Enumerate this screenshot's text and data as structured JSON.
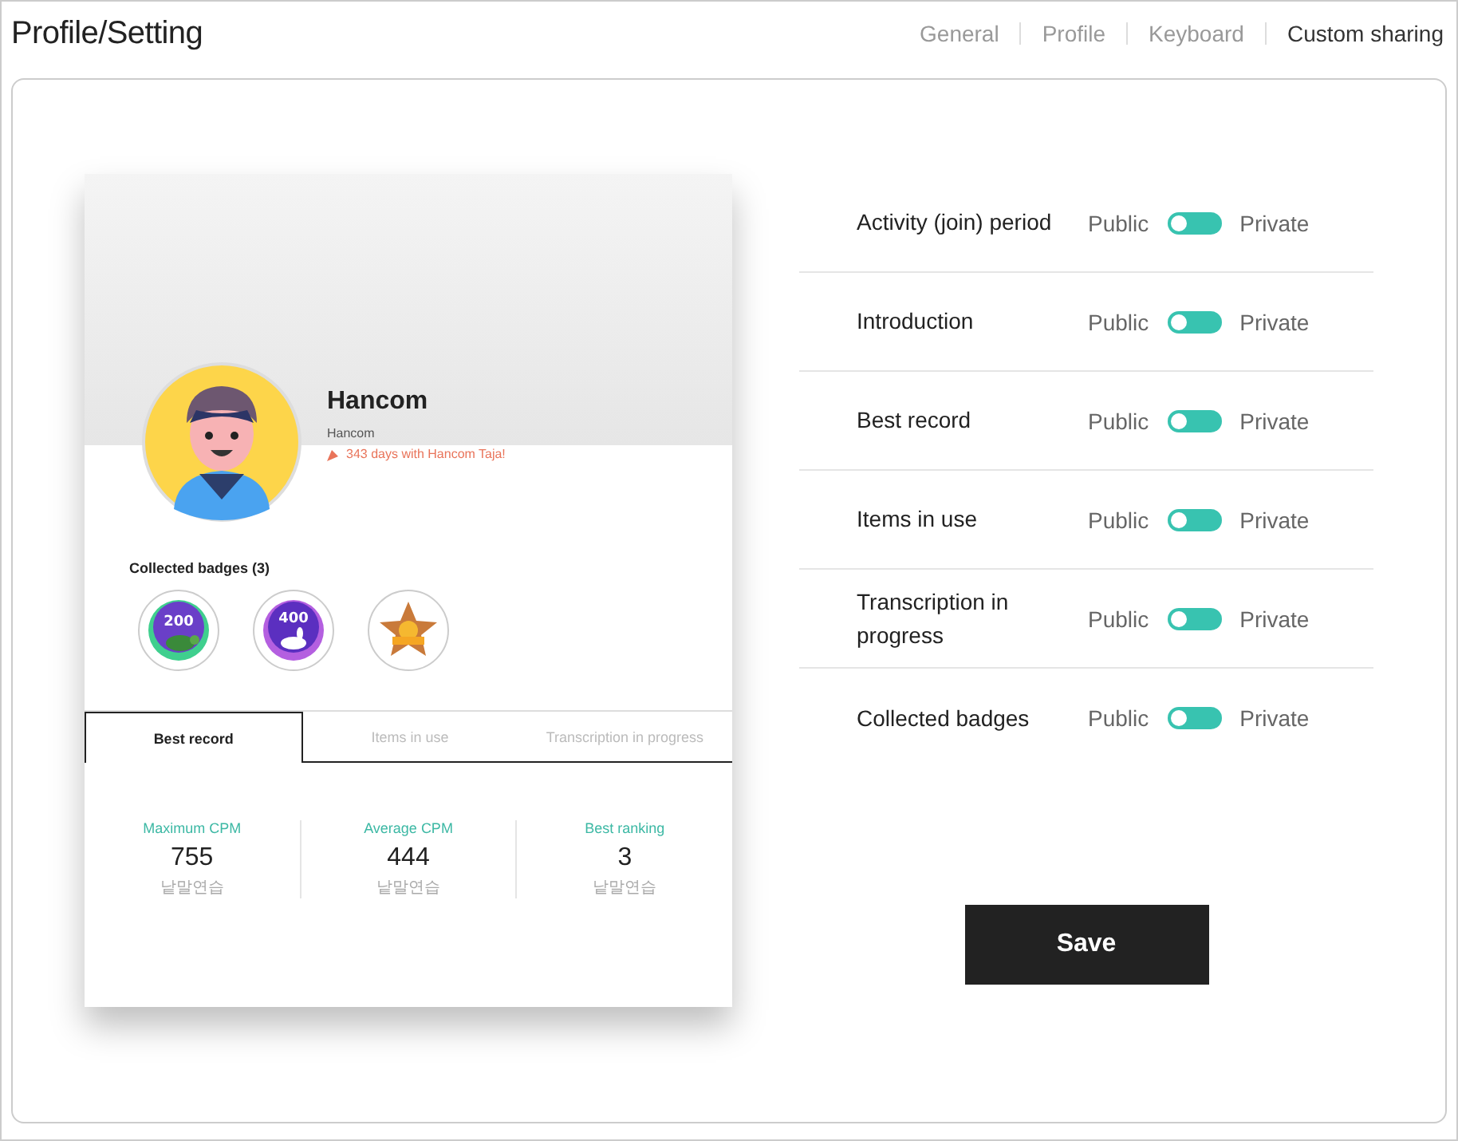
{
  "header": {
    "title": "Profile/Setting",
    "tabs": [
      {
        "label": "General",
        "selected": false
      },
      {
        "label": "Profile",
        "selected": false
      },
      {
        "label": "Keyboard",
        "selected": false
      },
      {
        "label": "Custom sharing",
        "selected": true
      }
    ]
  },
  "profile_card": {
    "name": "Hancom",
    "username": "Hancom",
    "days": "343 days with Hancom Taja!",
    "badges_title": "Collected badges (3)",
    "badges": [
      {
        "kind": "turtle",
        "label": "200"
      },
      {
        "kind": "rabbit",
        "label": "400"
      },
      {
        "kind": "star"
      }
    ],
    "tabs": [
      {
        "label": "Best record",
        "selected": true
      },
      {
        "label": "Items in use",
        "selected": false
      },
      {
        "label": "Transcription in progress",
        "selected": false
      }
    ],
    "stats": [
      {
        "label": "Maximum CPM",
        "value": "755",
        "caption": "낱말연습"
      },
      {
        "label": "Average CPM",
        "value": "444",
        "caption": "낱말연습"
      },
      {
        "label": "Best ranking",
        "value": "3",
        "caption": "낱말연습"
      }
    ]
  },
  "settings": [
    {
      "name": "Activity (join) period",
      "left": "Public",
      "right": "Private",
      "private": false
    },
    {
      "name": "Introduction",
      "left": "Public",
      "right": "Private",
      "private": false
    },
    {
      "name": "Best record",
      "left": "Public",
      "right": "Private",
      "private": false
    },
    {
      "name": "Items in use",
      "left": "Public",
      "right": "Private",
      "private": false
    },
    {
      "name": "Transcription in progress",
      "left": "Public",
      "right": "Private",
      "private": false
    },
    {
      "name": "Collected badges",
      "left": "Public",
      "right": "Private",
      "private": false
    }
  ],
  "save_button": "Save"
}
